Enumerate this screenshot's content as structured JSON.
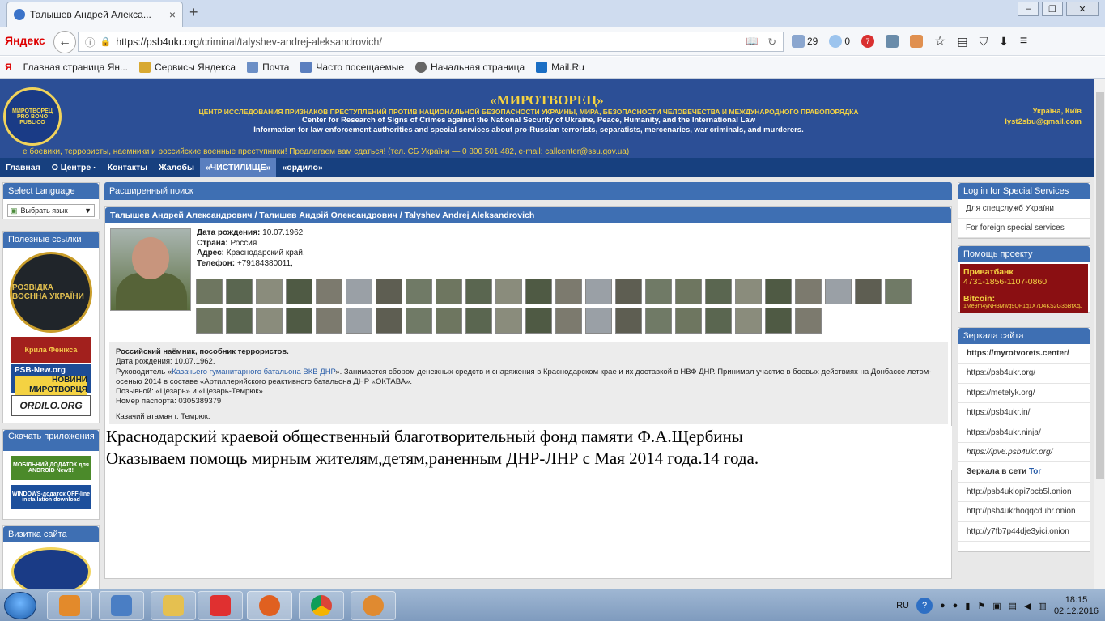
{
  "browser": {
    "tab_title": "Талышев Андрей Алекса...",
    "tab_close": "×",
    "new_tab": "+",
    "window": {
      "minimize": "–",
      "maximize": "❐",
      "close": "✕"
    },
    "brand": "Яндекс",
    "back": "←",
    "url_domain": "https://psb4ukr.org",
    "url_path": "/criminal/talyshev-andrej-aleksandrovich/",
    "mail_count": "29",
    "cloud_count": "0",
    "red_badge": "7",
    "bookmarks": [
      "Главная страница Ян...",
      "Сервисы Яндекса",
      "Почта",
      "Часто посещаемые",
      "Начальная страница",
      "Mail.Ru"
    ]
  },
  "header": {
    "logo_text": "МИРОТВОРЕЦ PRO BONO PUBLICO",
    "title": "«МИРОТВОРЕЦ»",
    "sub1": "ЦЕНТР ИССЛЕДОВАНИЯ ПРИЗНАКОВ ПРЕСТУПЛЕНИЙ ПРОТИВ НАЦИОНАЛЬНОЙ БЕЗОПАСНОСТИ УКРАИНЫ, МИРА, БЕЗОПАСНОСТИ ЧЕЛОВЕЧЕСТВА И МЕЖДУНАРОДНОГО ПРАВОПОРЯДКА",
    "sub2": "Center for Research of Signs of Crimes against the National Security of Ukraine, Peace, Humanity, and the International Law",
    "sub3": "Information for law enforcement authorities and special services about pro-Russian terrorists, separatists, mercenaries, war criminals, and murderers.",
    "location": "Україна, Київ",
    "email": "lyst2sbu@gmail.com",
    "ticker": "е боевики, террористы, наемники и российские военные преступники! Предлагаем вам сдаться! (тел. СБ України — 0 800 501 482, e-mail: callcenter@ssu.gov.ua)"
  },
  "menu": [
    "Главная",
    "О Центре ·",
    "Контакты",
    "Жалобы",
    "«ЧИСТИЛИЩЕ»",
    "«ордило»"
  ],
  "left": {
    "lang_title": "Select Language",
    "lang_select": "Выбрать язык",
    "useful_title": "Полезные ссылки",
    "badge_text": "РОЗВІДКА ВОЄННА УКРАЇНИ",
    "kp_text": "Крила Фенікса",
    "psb_line1": "PSB-New.org",
    "psb_line2": "НОВИНИ МИРОТВОРЦЯ",
    "ordilo": "ORDILO.ORG",
    "apps_title": "Скачать приложения",
    "app_android": "МОБІЛЬНИЙ ДОДАТОК для ANDROID New!!!",
    "app_windows": "WINDOWS-додаток OFF-line installation download",
    "visit_title": "Визитка сайта"
  },
  "center": {
    "search_title": "Расширенный поиск",
    "person_title": "Талышев Андрей Александрович / Талишев Андрій Олександрович / Talyshev Andrej Aleksandrovich",
    "facts": [
      {
        "label": "Дата рождения:",
        "value": " 10.07.1962"
      },
      {
        "label": "Страна:",
        "value": " Россия"
      },
      {
        "label": "Адрес:",
        "value": " Краснодарский край,"
      },
      {
        "label": "Телефон:",
        "value": " +79184380011,"
      }
    ],
    "desc_title": "Российский наёмник, пособник террористов.",
    "desc_birth": "Дата рождения: 10.07.1962.",
    "desc_lead": "Руководитель «",
    "desc_link": "Казачьего гуманитарного батальона ВКВ ДНР",
    "desc_rest": "». Занимается сбором денежных средств и снаряжения в  Краснодарском крае и их доставкой в НВФ ДНР.  Принимал участие в боевых действиях на Донбассе летом-осенью 2014 в составе «Артиллерийского реактивного батальона ДНР «ОКТАВА».",
    "desc_callsign": "Позывной: «Цезарь» и «Цезарь-Темрюк».",
    "desc_passport": "Номер паспорта: 0305389379",
    "desc_ataman": "Казачий атаман г. Темрюк.",
    "overlay1": "Краснодарский краевой общественный благотворительный фонд памяти Ф.А.Щербины",
    "overlay2": "Оказываем помощь мирным жителям,детям,раненным ДНР-ЛНР с Мая 2014 года.14 года.",
    "thumb_count": 45
  },
  "right": {
    "login_title": "Log in for Special Services",
    "login_ua": "Для спецслужб України",
    "login_foreign": "For foreign special services",
    "donate_title": "Помощь проекту",
    "bank": "Приватбанк",
    "card": "4731-1856-1107-0860",
    "bitcoin": "Bitcoin:",
    "btc_addr": "1Me9m4yNH3Mwq9QF1q1X7D4KS2G36BtXqJ",
    "mirrors_title": "Зеркала сайта",
    "mirrors": [
      "https://myrotvorets.center/",
      "https://psb4ukr.org/",
      "https://metelyk.org/",
      "https://psb4ukr.in/",
      "https://psb4ukr.ninja/",
      "https://ipv6.psb4ukr.org/"
    ],
    "tor_label": "Зеркала в сети ",
    "tor_word": "Tor",
    "onion": [
      "http://psb4uklopi7ocb5l.onion",
      "http://psb4ukrhoqqcdubr.onion",
      "http://y7fb7p44dje3yici.onion"
    ]
  },
  "taskbar": {
    "lang": "RU",
    "time": "18:15",
    "date": "02.12.2016"
  }
}
